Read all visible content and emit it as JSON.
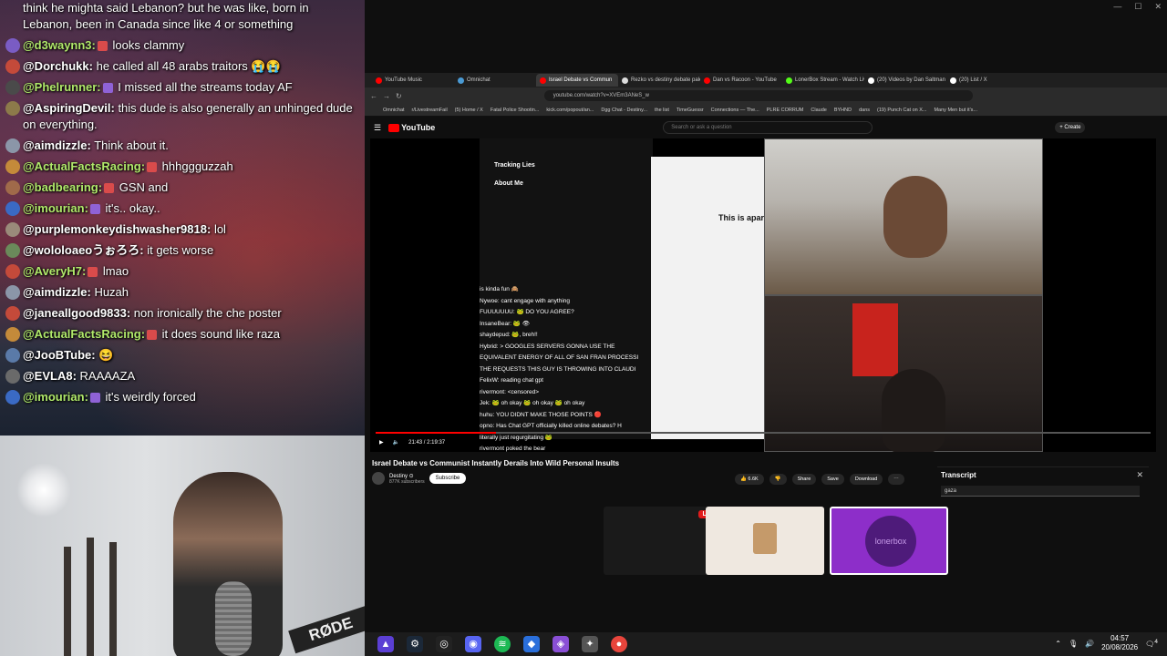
{
  "chat": {
    "messages": [
      {
        "user": "",
        "text": "think he mighta said Lebanon? but he was like, born in Lebanon, been in Canada since like 4 or something",
        "user_color": "#ffffff",
        "avatar_color": "#666666"
      },
      {
        "user": "@d3waynn3:",
        "text": "looks clammy",
        "user_color": "#b0e96a",
        "avatar_color": "#7a5cc4",
        "badge": "#d94b4b"
      },
      {
        "user": "@Dorchukk:",
        "text": "he called all 48 arabs traitors 😭😭",
        "user_color": "#ffffff",
        "avatar_color": "#c44a3a"
      },
      {
        "user": "@Phelrunner:",
        "text": "I missed all the streams today AF",
        "user_color": "#b0e96a",
        "avatar_color": "#4a4a4a",
        "badge": "#8f62d6"
      },
      {
        "user": "@AspiringDevil:",
        "text": "this dude is also generally an unhinged dude on everything.",
        "user_color": "#ffffff",
        "avatar_color": "#8c7a4a"
      },
      {
        "user": "@aimdizzle:",
        "text": "Think about it.",
        "user_color": "#ffffff",
        "avatar_color": "#8b96a8"
      },
      {
        "user": "@ActualFactsRacing:",
        "text": "hhhggguzzah",
        "user_color": "#b0e96a",
        "avatar_color": "#c48a3a",
        "badge": "#d94b4b"
      },
      {
        "user": "@badbearing:",
        "text": "GSN and",
        "user_color": "#b0e96a",
        "avatar_color": "#a06a4a",
        "badge": "#d94b4b"
      },
      {
        "user": "@imourian:",
        "text": "it's.. okay..",
        "user_color": "#b0e96a",
        "avatar_color": "#3a6ac4",
        "badge": "#8f62d6"
      },
      {
        "user": "@purplemonkeydishwasher9818:",
        "text": "lol",
        "user_color": "#ffffff",
        "avatar_color": "#9a8a7a"
      },
      {
        "user": "@wololoaeoうぉろろ:",
        "text": "it gets worse",
        "user_color": "#ffffff",
        "avatar_color": "#6a8a5a"
      },
      {
        "user": "@AveryH7:",
        "text": "lmao",
        "user_color": "#b0e96a",
        "avatar_color": "#c44a3a",
        "badge": "#d94b4b"
      },
      {
        "user": "@aimdizzle:",
        "text": "Huzah",
        "user_color": "#ffffff",
        "avatar_color": "#8b96a8"
      },
      {
        "user": "@janeallgood9833:",
        "text": "non ironically the che poster",
        "user_color": "#ffffff",
        "avatar_color": "#c44a3a"
      },
      {
        "user": "@ActualFactsRacing:",
        "text": "it does sound like raza",
        "user_color": "#b0e96a",
        "avatar_color": "#c48a3a",
        "badge": "#d94b4b"
      },
      {
        "user": "@JooBTube:",
        "text": "😆",
        "user_color": "#ffffff",
        "avatar_color": "#5a7aa8"
      },
      {
        "user": "@EVLA8:",
        "text": "RAAAAZA",
        "user_color": "#ffffff",
        "avatar_color": "#6a6a6a"
      },
      {
        "user": "@imourian:",
        "text": "it's weirdly forced",
        "user_color": "#b0e96a",
        "avatar_color": "#3a6ac4",
        "badge": "#8f62d6"
      }
    ]
  },
  "webcam": {
    "mic_brand": "RØDE"
  },
  "browser": {
    "tabs": [
      {
        "label": "YouTube Music",
        "active": false,
        "color": "#ff0000"
      },
      {
        "label": "Omnichat",
        "active": false,
        "color": "#4a9ad4"
      },
      {
        "label": "Israel Debate vs Commun",
        "active": true,
        "color": "#ff0000"
      },
      {
        "label": "Rezko vs destiny debate pale",
        "active": false,
        "color": "#dddddd"
      },
      {
        "label": "Dan vs Racoon - YouTube",
        "active": false,
        "color": "#ff0000"
      },
      {
        "label": "LonerBox Stream - Watch Liv",
        "active": false,
        "color": "#53fc18"
      },
      {
        "label": "(20) Videos by Dan Saltman",
        "active": false,
        "color": "#ffffff"
      },
      {
        "label": "(20) List / X",
        "active": false,
        "color": "#ffffff"
      }
    ],
    "address": "youtube.com/watch?v=XVEm3ANeS_w",
    "bookmarks": [
      "Omnichat",
      "r/LivestreamFail",
      "(5) Home / X",
      "Fatal Police Shootin...",
      "kick.com/popout/an...",
      "Dgg Chat - Destiny...",
      "the list",
      "TimeGuessr",
      "Connections — The...",
      "PLRE CORRUM",
      "Claude",
      "BYHND",
      "dans",
      "(19) Punch Cat on X...",
      "Many Men but it's..."
    ]
  },
  "youtube": {
    "logo_text": "YouTube",
    "search_placeholder": "Search or ask a question",
    "create_label": "+ Create",
    "video_title": "Israel Debate vs Communist Instantly Derails Into Wild Personal Insults",
    "channel_name": "Destiny ⊙",
    "channel_subs": "877K subscribers",
    "subscribe_label": "Subscribe",
    "time": "21:43 / 2:19:37",
    "progress": 0.155,
    "likes_label": "6.6K",
    "share_label": "Share",
    "save_label": "Save",
    "download_label": "Download",
    "transcript_title": "Transcript",
    "transcript_search": "gaza"
  },
  "screen": {
    "heading1": "Tracking Lies",
    "heading2": "About Me",
    "doc_title": "This is apar",
    "chat_lines": [
      "is kinda fun 🙈",
      "Nywoe: cant engage with anything",
      "FUUUUUUU: 🐸 DO YOU AGREE?",
      "InsaneBear: 🐸 👁",
      "shaydepud: 🐸, breh!!",
      "Hybrid: > GOOGLES SERVERS GONNA USE THE",
      "EQUIVALENT ENERGY OF ALL OF SAN FRAN PROCESSI",
      "THE REQUESTS THIS GUY IS THROWING INTO CLAUDI",
      "FelixW: reading chat gpt",
      "rivermont: <censored>",
      "Jek: 🐸 oh okay 🐸 oh okay 🐸 oh okay",
      "huhu: YOU DIDNT MAKE THOSE POINTS 🔴",
      "opno: Has Chat GPT officially killed online debates? H",
      "literally just regurgitating 🐸",
      "rivermont poked the bear"
    ]
  },
  "lower": {
    "live_label": "LIVE",
    "lonerbox_label": "lonerbox"
  },
  "taskbar": {
    "time": "04:57",
    "date": "20/08/2026",
    "notif_count": "4"
  }
}
